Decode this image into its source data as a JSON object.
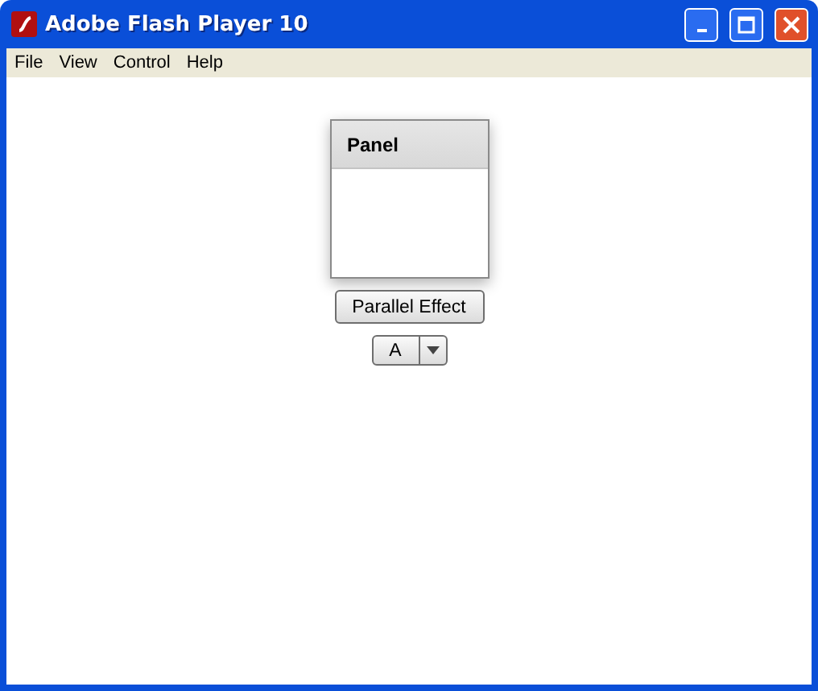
{
  "window": {
    "title": "Adobe Flash Player 10"
  },
  "menu": [
    "File",
    "View",
    "Control",
    "Help"
  ],
  "panel": {
    "title": "Panel"
  },
  "button": {
    "label": "Parallel Effect"
  },
  "dropdown": {
    "value": "A"
  }
}
